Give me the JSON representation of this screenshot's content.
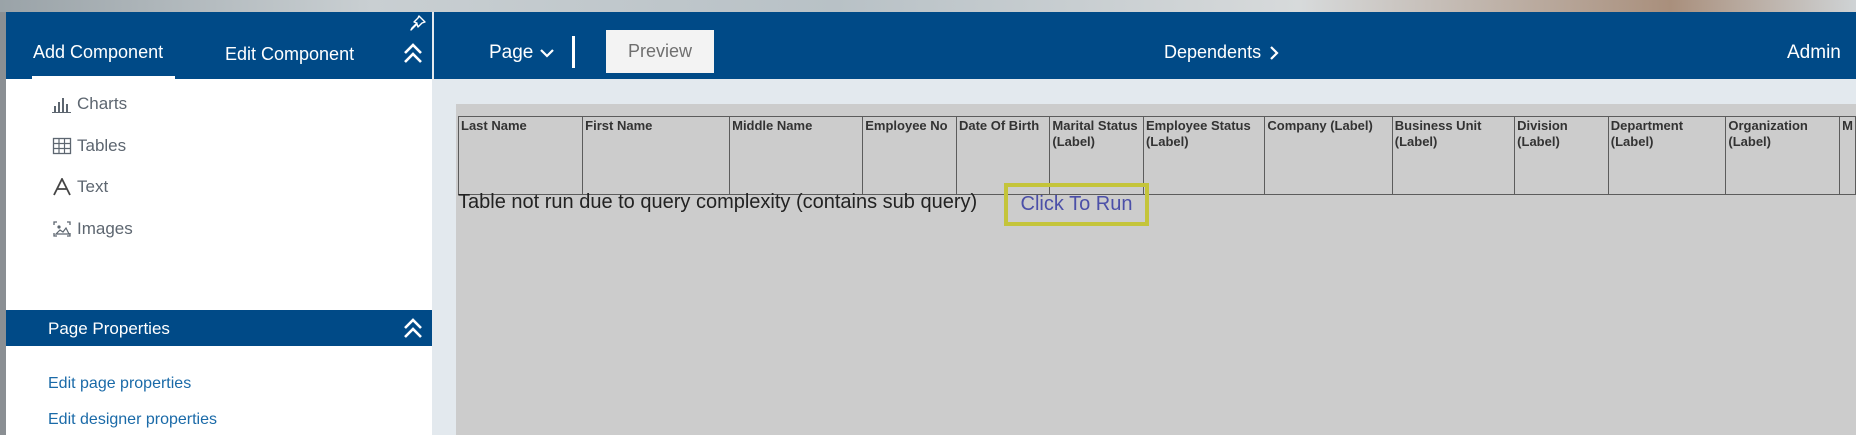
{
  "left_panel": {
    "tabs": [
      {
        "label": "Add Component"
      },
      {
        "label": "Edit Component"
      }
    ],
    "components": [
      {
        "label": "Charts",
        "icon": "bar-chart-icon"
      },
      {
        "label": "Tables",
        "icon": "table-icon"
      },
      {
        "label": "Text",
        "icon": "text-icon"
      },
      {
        "label": "Images",
        "icon": "image-icon"
      }
    ],
    "page_properties": {
      "title": "Page Properties",
      "links": [
        {
          "label": "Edit page properties"
        },
        {
          "label": "Edit designer properties"
        }
      ]
    }
  },
  "header": {
    "page_menu": "Page",
    "preview": "Preview",
    "breadcrumb": "Dependents",
    "user": "Admin"
  },
  "table": {
    "columns": [
      "Last Name",
      "First Name",
      "Middle Name",
      "Employee No",
      "Date Of Birth",
      "Marital Status (Label)",
      "Employee Status (Label)",
      "Company (Label)",
      "Business Unit (Label)",
      "Division (Label)",
      "Department (Label)",
      "Organization (Label)",
      "M"
    ],
    "message": "Table not run due to query complexity (contains sub query)",
    "run_link": "Click To Run"
  },
  "colors": {
    "brand": "#004a87",
    "link": "#1a6aa8",
    "highlight_border": "#c4c43a"
  }
}
